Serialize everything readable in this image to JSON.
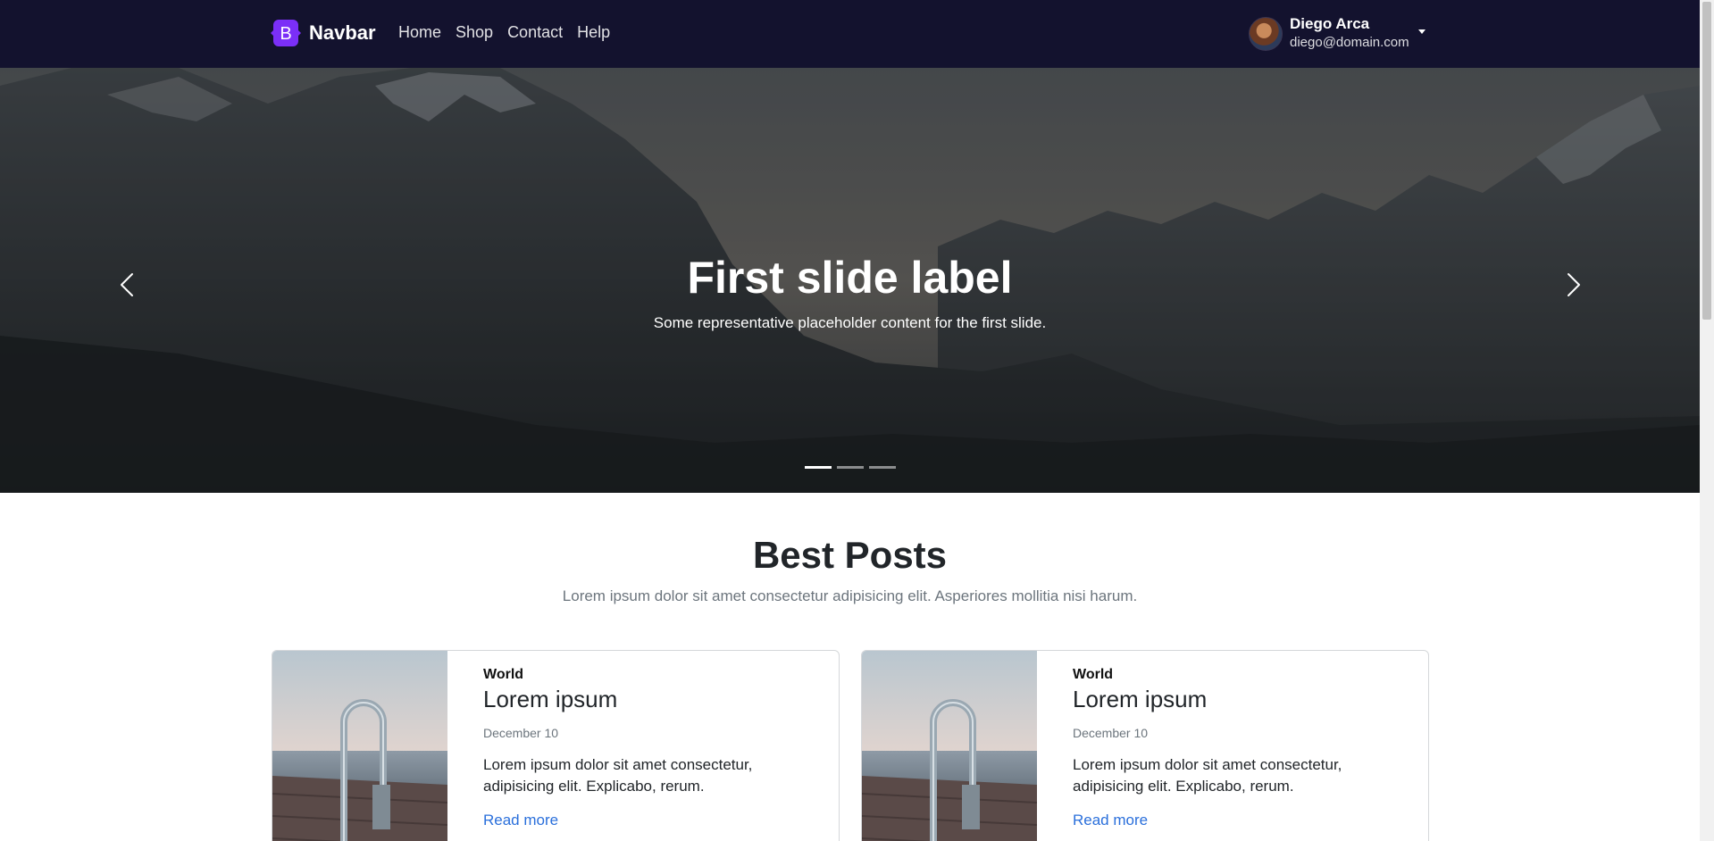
{
  "navbar": {
    "brand_letter": "B",
    "brand_name": "Navbar",
    "links": [
      {
        "label": "Home"
      },
      {
        "label": "Shop"
      },
      {
        "label": "Contact"
      },
      {
        "label": "Help"
      }
    ],
    "user": {
      "name": "Diego Arca",
      "email": "diego@domain.com",
      "avatar_icon": "user-avatar"
    },
    "colors": {
      "background": "#13122e",
      "brand": "#7b2ff7"
    }
  },
  "carousel": {
    "title": "First slide label",
    "caption": "Some representative placeholder content for the first slide.",
    "slide_count": 3,
    "active_slide": 1,
    "prev_icon": "chevron-left-icon",
    "next_icon": "chevron-right-icon"
  },
  "section": {
    "title": "Best Posts",
    "subtitle": "Lorem ipsum dolor sit amet consectetur adipisicing elit. Asperiores mollitia nisi harum."
  },
  "posts": [
    {
      "category": "World",
      "title": "Lorem ipsum",
      "date": "December 10",
      "excerpt": "Lorem ipsum dolor sit amet consectetur, adipisicing elit. Explicabo, rerum.",
      "link": "Read more"
    },
    {
      "category": "World",
      "title": "Lorem ipsum",
      "date": "December 10",
      "excerpt": "Lorem ipsum dolor sit amet consectetur, adipisicing elit. Explicabo, rerum.",
      "link": "Read more"
    }
  ],
  "link_color": "#2a6fdb"
}
